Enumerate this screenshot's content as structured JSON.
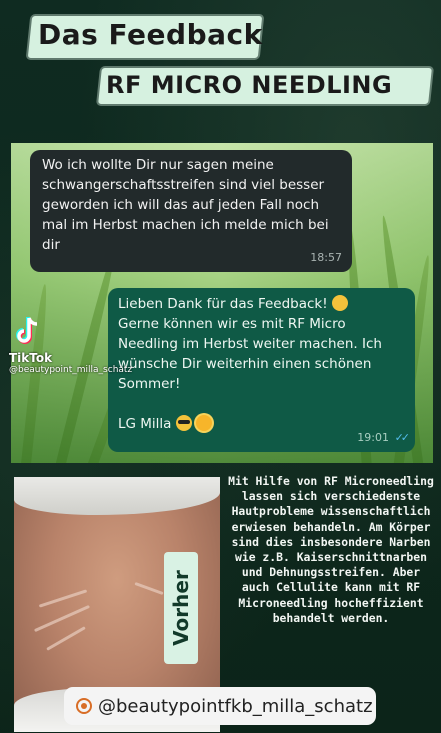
{
  "header": {
    "title_line1": "Das Feedback",
    "title_line2": "RF MICRO NEEDLING"
  },
  "chat": {
    "incoming": {
      "text": "Wo ich wollte Dir nur sagen meine schwangerschaftsstreifen sind viel besser geworden ich will das auf jeden Fall noch mal im Herbst machen ich melde mich bei dir",
      "time": "18:57"
    },
    "outgoing": {
      "line1": "Lieben Dank für das Feedback!",
      "line1_emoji": "smiling-face-with-hearts",
      "rest": "Gerne können wir es mit RF Micro Needling im Herbst weiter machen. Ich wünsche Dir weiterhin einen schönen Sommer!",
      "sign": "LG Milla",
      "sign_emojis": [
        "sunglasses-face",
        "sun"
      ],
      "time": "19:01",
      "status": "read-double-check"
    }
  },
  "watermark": {
    "app": "TikTok",
    "handle": "@beautypoint_milla_schatz"
  },
  "photo": {
    "label": "Vorher"
  },
  "info": {
    "text": "Mit Hilfe von RF Microneedling lassen sich verschiedenste Hautprobleme wissenschaftlich erwiesen behandeln. Am Körper sind dies insbesondere Narben wie z.B. Kaiserschnittnarben und Dehnungsstreifen. Aber auch Cellulite kann mit RF Microneedling hocheffizient behandelt werden."
  },
  "footer": {
    "handle": "@beautypointfkb_milla_schatz"
  },
  "colors": {
    "background": "#0e2a1f",
    "banner": "#d6f1e0",
    "incoming_bubble": "#222a2b",
    "outgoing_bubble": "#0f5a46",
    "read_ticks": "#53bdeb"
  }
}
